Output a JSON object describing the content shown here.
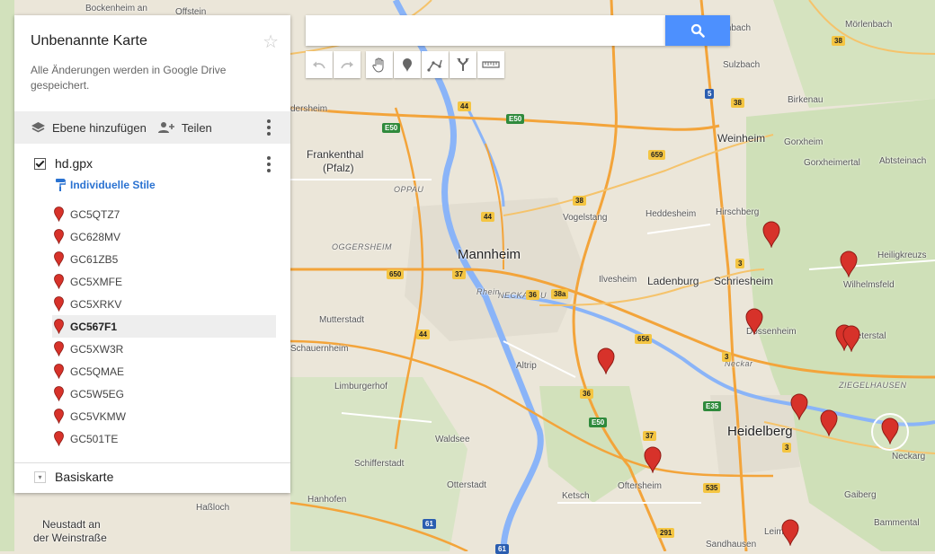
{
  "panel": {
    "title": "Unbenannte Karte",
    "subtitle": "Alle Änderungen werden in Google Drive gespeichert.",
    "add_layer": "Ebene hinzufügen",
    "share": "Teilen",
    "layer_name": "hd.gpx",
    "styles_label": "Individuelle Stile",
    "items": [
      "GC5QTZ7",
      "GC628MV",
      "GC61ZB5",
      "GC5XMFE",
      "GC5XRKV",
      "GC567F1",
      "GC5XW3R",
      "GC5QMAE",
      "GC5W5EG",
      "GC5VKMW",
      "GC501TE"
    ],
    "selected_item": "GC567F1",
    "basemap_label": "Basiskarte"
  },
  "search": {
    "value": "",
    "placeholder": ""
  },
  "toolbar_icons": [
    "undo-icon",
    "redo-icon",
    "hand-icon",
    "marker-icon",
    "line-icon",
    "route-icon",
    "ruler-icon"
  ],
  "colors": {
    "accent": "#4d90fe",
    "marker": "#d7322a",
    "road": "#f3a43a"
  },
  "map": {
    "labels": [
      {
        "text": "Bockenheim an",
        "cls": "sm"
      },
      {
        "text": "Offstein",
        "cls": "sm"
      },
      {
        "text": "Laudenbach",
        "cls": "sm"
      },
      {
        "text": "Mörlenbach",
        "cls": "sm"
      },
      {
        "text": "Sulzbach",
        "cls": "sm"
      },
      {
        "text": "Birkenau",
        "cls": "sm"
      },
      {
        "text": "Weinheim",
        "cls": ""
      },
      {
        "text": "Gorxheim",
        "cls": "sm"
      },
      {
        "text": "Gorxheimertal",
        "cls": "sm"
      },
      {
        "text": "Abtsteinach",
        "cls": "sm"
      },
      {
        "text": "Frankenthal",
        "cls": ""
      },
      {
        "text": "(Pfalz)",
        "cls": ""
      },
      {
        "text": "dersheim",
        "cls": "sm"
      },
      {
        "text": "OPPAU",
        "cls": "ital"
      },
      {
        "text": "OGGERSHEIM",
        "cls": "ital"
      },
      {
        "text": "Vogelstang",
        "cls": "sm"
      },
      {
        "text": "Heddesheim",
        "cls": "sm"
      },
      {
        "text": "Hirschberg",
        "cls": "sm"
      },
      {
        "text": "Heiligkreuzs",
        "cls": "sm"
      },
      {
        "text": "Mannheim",
        "cls": "big"
      },
      {
        "text": "Ilvesheim",
        "cls": "sm"
      },
      {
        "text": "Ladenburg",
        "cls": ""
      },
      {
        "text": "Schriesheim",
        "cls": ""
      },
      {
        "text": "Wilhelmsfeld",
        "cls": "sm"
      },
      {
        "text": "NECKARAU",
        "cls": "ital"
      },
      {
        "text": "Rhein",
        "cls": "ital"
      },
      {
        "text": "Mutterstadt",
        "cls": "sm"
      },
      {
        "text": "Dossenheim",
        "cls": "sm"
      },
      {
        "text": "Peterstal",
        "cls": "sm"
      },
      {
        "text": "Schauernheim",
        "cls": "sm"
      },
      {
        "text": "Altrip",
        "cls": "sm"
      },
      {
        "text": "Neckar",
        "cls": "ital"
      },
      {
        "text": "Limburgerhof",
        "cls": "sm"
      },
      {
        "text": "ZIEGELHAUSEN",
        "cls": "ital"
      },
      {
        "text": "Heidelberg",
        "cls": "big"
      },
      {
        "text": "Neckarg",
        "cls": "sm"
      },
      {
        "text": "Waldsee",
        "cls": "sm"
      },
      {
        "text": "Schifferstadt",
        "cls": "sm"
      },
      {
        "text": "Oftersheim",
        "cls": "sm"
      },
      {
        "text": "Otterstadt",
        "cls": "sm"
      },
      {
        "text": "Ketsch",
        "cls": "sm"
      },
      {
        "text": "Gaiberg",
        "cls": "sm"
      },
      {
        "text": "Hanhofen",
        "cls": "sm"
      },
      {
        "text": "Haßloch",
        "cls": "sm"
      },
      {
        "text": "Neustadt an",
        "cls": ""
      },
      {
        "text": "der Weinstraße",
        "cls": ""
      },
      {
        "text": "Bammental",
        "cls": "sm"
      },
      {
        "text": "Sandhausen",
        "cls": "sm"
      },
      {
        "text": "Leimen",
        "cls": "sm"
      }
    ],
    "shields": [
      {
        "text": "38",
        "cls": "yel"
      },
      {
        "text": "38",
        "cls": "yel"
      },
      {
        "text": "5",
        "cls": "blu"
      },
      {
        "text": "44",
        "cls": "yel"
      },
      {
        "text": "E50",
        "cls": "grn"
      },
      {
        "text": "E50",
        "cls": "grn"
      },
      {
        "text": "659",
        "cls": "yel"
      },
      {
        "text": "38",
        "cls": "yel"
      },
      {
        "text": "44",
        "cls": "yel"
      },
      {
        "text": "650",
        "cls": "yel"
      },
      {
        "text": "37",
        "cls": "yel"
      },
      {
        "text": "36",
        "cls": "yel"
      },
      {
        "text": "38a",
        "cls": "yel"
      },
      {
        "text": "3",
        "cls": "yel"
      },
      {
        "text": "656",
        "cls": "yel"
      },
      {
        "text": "44",
        "cls": "yel"
      },
      {
        "text": "3",
        "cls": "yel"
      },
      {
        "text": "36",
        "cls": "yel"
      },
      {
        "text": "E50",
        "cls": "grn"
      },
      {
        "text": "E35",
        "cls": "grn"
      },
      {
        "text": "37",
        "cls": "yel"
      },
      {
        "text": "3",
        "cls": "yel"
      },
      {
        "text": "535",
        "cls": "yel"
      },
      {
        "text": "61",
        "cls": "blu"
      },
      {
        "text": "61",
        "cls": "blu"
      },
      {
        "text": "291",
        "cls": "yel"
      }
    ]
  }
}
